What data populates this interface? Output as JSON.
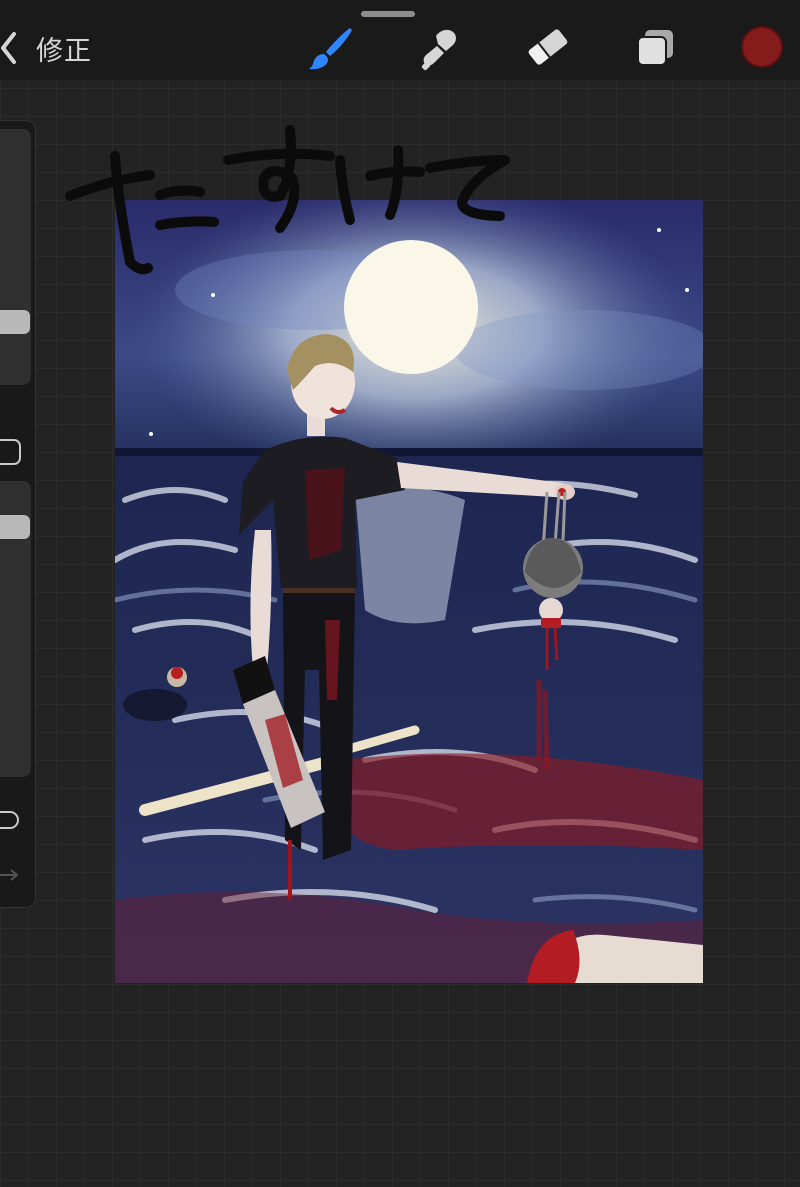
{
  "toolbar": {
    "back_label": "修正",
    "tools": [
      {
        "name": "brush",
        "icon": "brush-icon",
        "active": true
      },
      {
        "name": "smudge",
        "icon": "smudge-icon",
        "active": false
      },
      {
        "name": "eraser",
        "icon": "eraser-icon",
        "active": false
      },
      {
        "name": "layers",
        "icon": "layers-icon",
        "active": false
      }
    ],
    "current_color": "#841c1c",
    "accent_color": "#2f86ff"
  },
  "sidebar": {
    "brush_size_level": 0.22,
    "opacity_level": 0.25
  },
  "canvas": {
    "handwriting": "たすけて"
  }
}
